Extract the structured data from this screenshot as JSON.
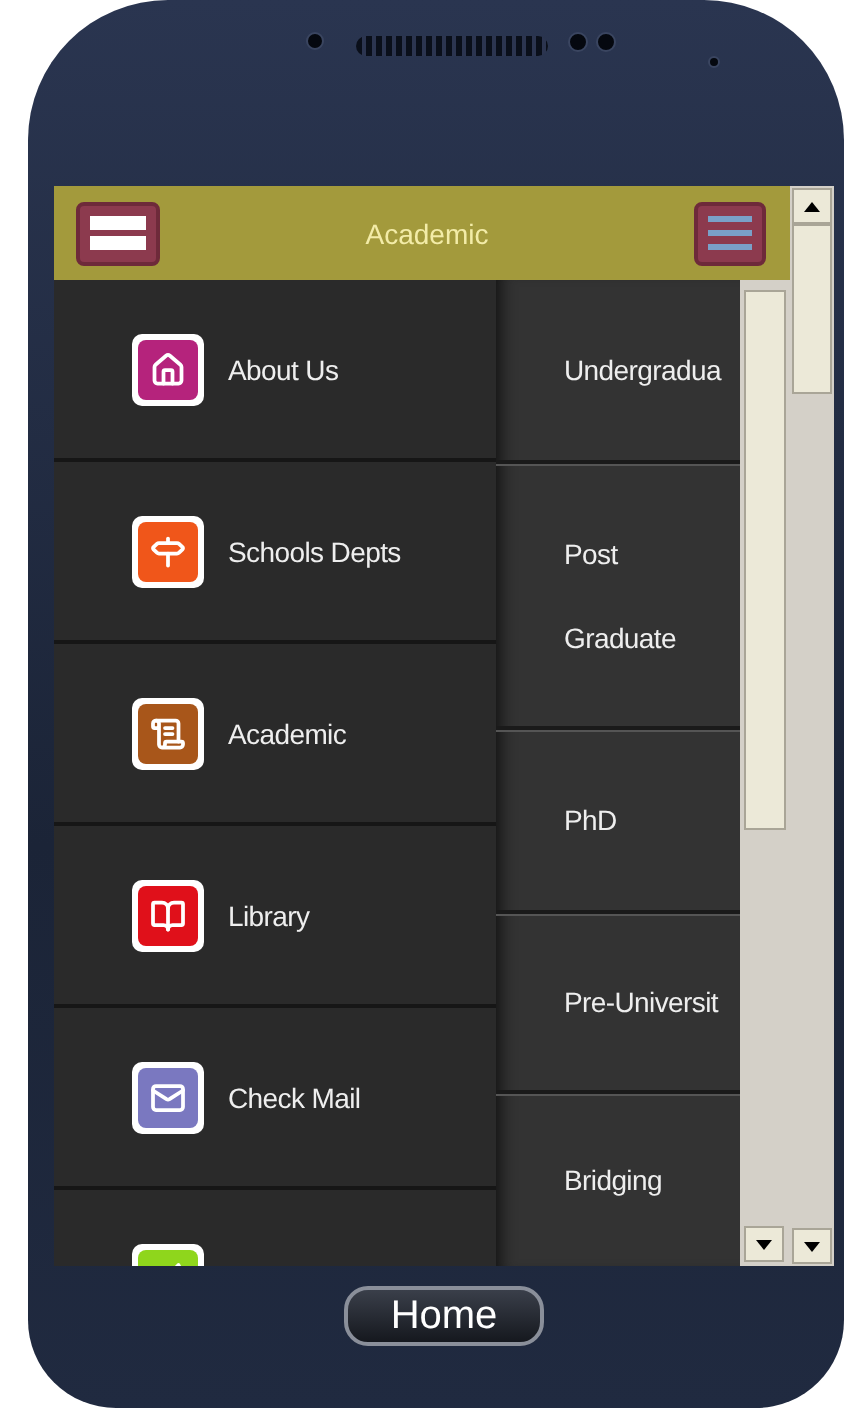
{
  "header": {
    "title": "Academic"
  },
  "menu": [
    {
      "label": "About Us",
      "color": "#b5237c"
    },
    {
      "label": "Schools Depts",
      "color": "#f0561a"
    },
    {
      "label": "Academic",
      "color": "#a8561a"
    },
    {
      "label": "Library",
      "color": "#e0101a"
    },
    {
      "label": "Check Mail",
      "color": "#7a78c0"
    },
    {
      "color": "#8fd61c"
    }
  ],
  "programs": [
    {
      "label": "Undergradua"
    },
    {
      "label": "Post Graduate"
    },
    {
      "label": "PhD"
    },
    {
      "label": "Pre-Universit"
    },
    {
      "label": "Bridging"
    }
  ],
  "home_button": {
    "label": "Home"
  }
}
